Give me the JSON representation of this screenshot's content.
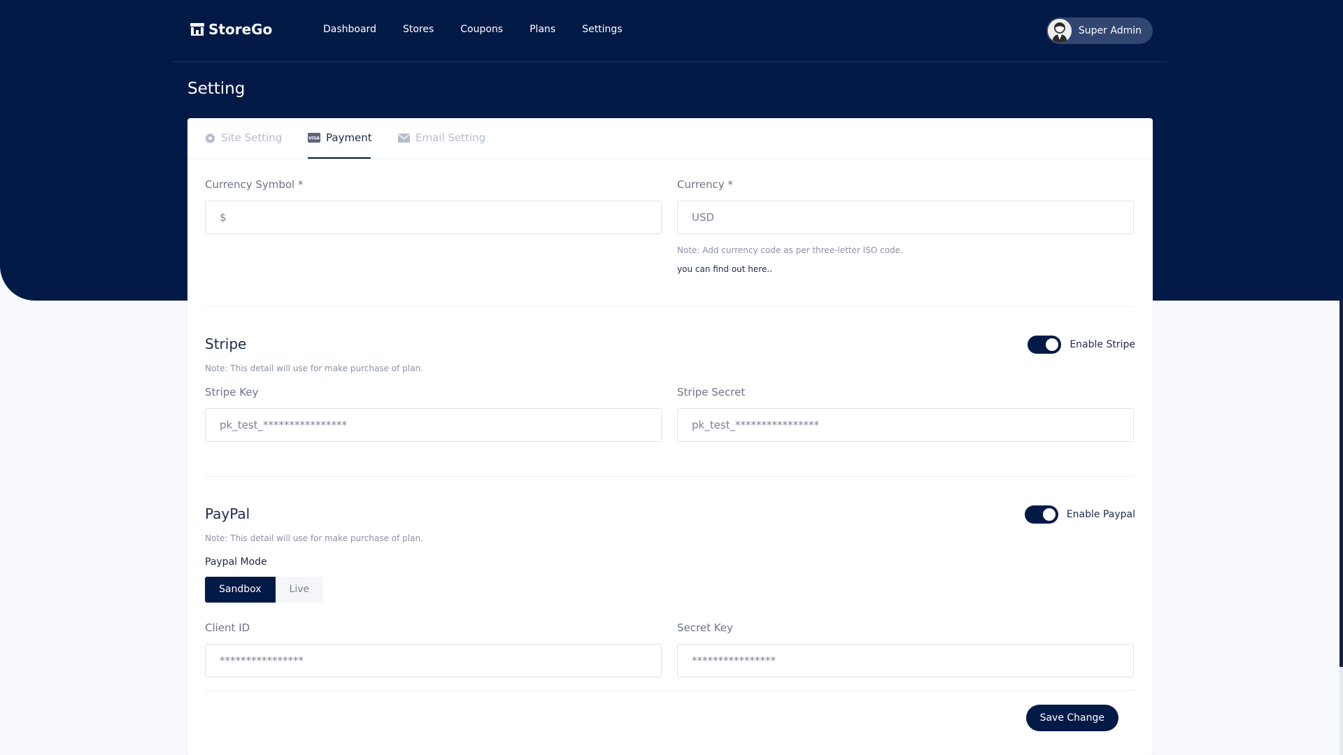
{
  "brand": {
    "name": "StoreGo"
  },
  "nav": {
    "items": [
      "Dashboard",
      "Stores",
      "Coupons",
      "Plans",
      "Settings"
    ]
  },
  "user": {
    "name": "Super Admin"
  },
  "page": {
    "title": "Setting"
  },
  "tabs": [
    {
      "label": "Site Setting",
      "icon": "gear-icon"
    },
    {
      "label": "Payment",
      "icon": "visa-card-icon",
      "active": true
    },
    {
      "label": "Email Setting",
      "icon": "envelope-icon"
    }
  ],
  "currency": {
    "symbol_label": "Currency Symbol *",
    "symbol_value": "$",
    "code_label": "Currency *",
    "code_value": "USD",
    "note": "Note: Add currency code as per three-letter ISO code.",
    "link": "you can find out here.."
  },
  "stripe": {
    "title": "Stripe",
    "toggle_label": "Enable Stripe",
    "enabled": true,
    "note": "Note: This detail will use for make purchase of plan.",
    "key_label": "Stripe Key",
    "key_value": "pk_test_****************",
    "secret_label": "Stripe Secret",
    "secret_value": "pk_test_****************"
  },
  "paypal": {
    "title": "PayPal",
    "toggle_label": "Enable Paypal",
    "enabled": true,
    "note": "Note: This detail will use for make purchase of plan.",
    "mode_label": "Paypal Mode",
    "modes": [
      "Sandbox",
      "Live"
    ],
    "selected_mode": "Sandbox",
    "client_label": "Client ID",
    "client_value": "****************",
    "secret_label": "Secret Key",
    "secret_value": "****************"
  },
  "actions": {
    "save": "Save Change"
  },
  "colors": {
    "primary": "#041a46",
    "background": "#f8f9fd"
  }
}
